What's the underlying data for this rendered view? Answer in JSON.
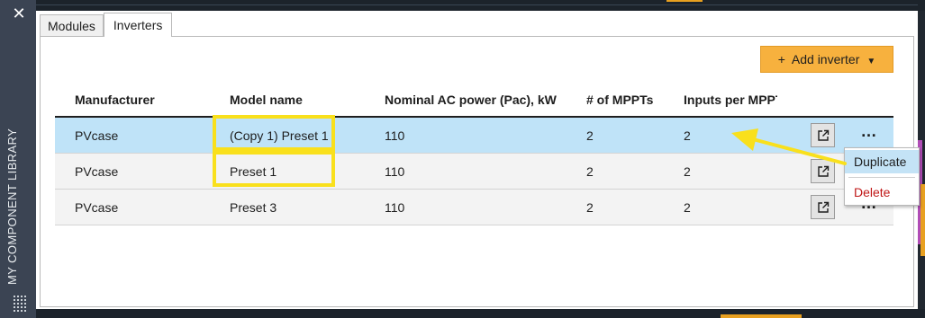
{
  "sidebar": {
    "title": "MY COMPONENT LIBRARY"
  },
  "tabs": [
    {
      "label": "Modules"
    },
    {
      "label": "Inverters"
    }
  ],
  "toolbar": {
    "add_label": "Add inverter"
  },
  "table": {
    "headers": [
      "Manufacturer",
      "Model name",
      "Nominal AC power (Pac), kW",
      "# of MPPTs",
      "Inputs per MPPT"
    ],
    "rows": [
      {
        "manufacturer": "PVcase",
        "model": "(Copy 1) Preset 1",
        "power": "110",
        "mppts": "2",
        "inputs": "2",
        "selected": true
      },
      {
        "manufacturer": "PVcase",
        "model": "Preset 1",
        "power": "110",
        "mppts": "2",
        "inputs": "2",
        "selected": false
      },
      {
        "manufacturer": "PVcase",
        "model": "Preset 3",
        "power": "110",
        "mppts": "2",
        "inputs": "2",
        "selected": false
      }
    ]
  },
  "context_menu": {
    "duplicate": "Duplicate",
    "delete": "Delete"
  },
  "colors": {
    "accent": "#f7b13e",
    "selected_row": "#bfe3f8",
    "highlight": "#f9e01c",
    "delete": "#c01818"
  }
}
